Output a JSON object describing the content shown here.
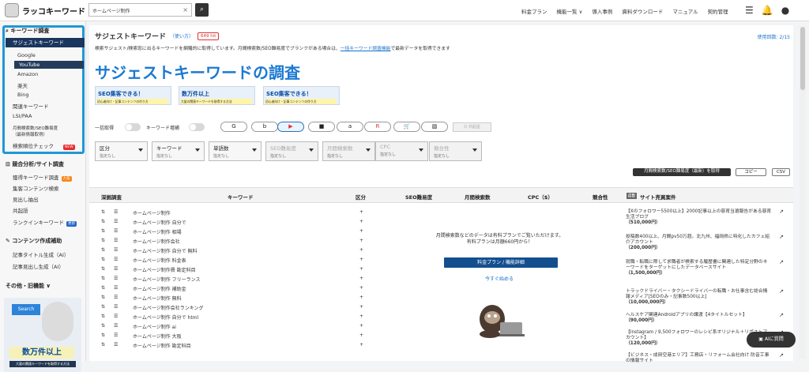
{
  "header": {
    "logo": "ラッコキーワード",
    "search_value": "ホームページ制作",
    "nav": [
      "料金プラン",
      "機能一覧 ∨",
      "導入事例",
      "資料ダウンロード",
      "マニュアル",
      "契約管理"
    ]
  },
  "sidebar": {
    "keyword_title": "キーワード調査",
    "active_item": "サジェストキーワード",
    "subitems": [
      "Google",
      "YouTube",
      "Amazon",
      "楽天",
      "Bing"
    ],
    "items": [
      "関連キーワード",
      "LSI/PAA",
      "月間検索数/SEO難易度",
      "（最新情報取得）",
      "検索順位チェック"
    ],
    "new_badge": "NEW",
    "competitor_title": "競合分析/サイト調査",
    "competitor_items": [
      "獲得キーワード調査",
      "集客コンテンツ検索",
      "見出し抽出",
      "共起語",
      "ランクインキーワード"
    ],
    "competitor_badge_1": "人気",
    "competitor_badge_2": "更新",
    "content_title": "コンテンツ作成補助",
    "content_items": [
      "記事タイトル生成（AI）",
      "記事見出し生成（AI）"
    ],
    "other_title": "その他・旧機能 ∨"
  },
  "ad": {
    "small_label": "Search",
    "title": "数万件以上",
    "bottom": "大量の関連キーワードを取得する方法"
  },
  "main": {
    "title": "サジェストキーワード",
    "howto": "（使い方）",
    "count": "649 hit",
    "usage": "使用回数: 2/15",
    "description": "検索サジェスト/検索窓に出るキーワードを網羅的に取得しています。月間検索数/SEO難易度でブランクがある場合は、",
    "description_link": "一括キーワード調査機能",
    "description_tail": "で最新データを取得できます",
    "heading": "サジェストキーワードの調査",
    "banners": [
      {
        "title": "SEO集客できる！",
        "sub": "初心者向け・記事コンテンツの作り方"
      },
      {
        "title": "数万件以上",
        "sub": "大量の関連キーワードを取得する方法"
      },
      {
        "title": "SEO集客できる！",
        "sub": "初心者向け・記事コンテンツの作り方"
      }
    ],
    "toggle_bulk": "一括取得",
    "toggle_growth": "キーワード増補",
    "engines": [
      "G",
      "b",
      "▶",
      "■",
      "a",
      "R",
      "🛒",
      "▧"
    ],
    "related_button": "Q 共起語",
    "filters": [
      {
        "label": "区分",
        "value": "指定なし",
        "disabled": false
      },
      {
        "label": "キーワード",
        "value": "指定なし",
        "disabled": false
      },
      {
        "label": "単語数",
        "value": "指定なし",
        "disabled": false
      },
      {
        "label": "SEO難易度",
        "value": "指定なし",
        "disabled": true
      },
      {
        "label": "月間検索数",
        "value": "指定なし",
        "disabled": true
      },
      {
        "label": "CPC",
        "value": "指定なし",
        "disabled": true
      },
      {
        "label": "競合性",
        "value": "指定なし",
        "disabled": true
      }
    ],
    "action_fetch": "月間検索数/SEO難易度（最新）を取得",
    "action_copy": "コピー",
    "action_csv": "CSV"
  },
  "table": {
    "headers": [
      "深掘調査",
      "キーワード",
      "区分",
      "SEO難易度",
      "月間検索数",
      "CPC（$）",
      "競合性",
      "サイト売買案件"
    ],
    "rows": [
      "ホームページ制作",
      "ホームページ制作 自分で",
      "ホームページ制作 相場",
      "ホームページ制作会社",
      "ホームページ制作 自分で 無料",
      "ホームページ制作 料金表",
      "ホームページ制作費 勘定科目",
      "ホームページ制作 フリーランス",
      "ホームページ制作 補助金",
      "ホームページ制作 無料",
      "ホームページ制作会社ランキング",
      "ホームページ制作 自分で html",
      "ホームページ制作 ai",
      "ホームページ制作 大阪",
      "ホームページ制作 勘定科目"
    ],
    "paywall_text_1": "月間検索数などのデータは有料プランでご覧いただけます。",
    "paywall_text_2": "有料プランは月額660円から！",
    "paywall_button": "料金プラン / 機能詳細",
    "paywall_link": "今すぐ始める",
    "case_badge": "広告",
    "cases": [
      {
        "title": "【Xのフォロワー5500以上】2000記事以上の慈育当選報告がある慈育生活ブログ",
        "price": "（510,000円）"
      },
      {
        "title": "投稿数400以上、月間pv50万超。北九州、福岡県に特化したカフェ紹介アカウント",
        "price": "（200,000円）"
      },
      {
        "title": "就職・転職に際して求職者が検索する履歴書に関連した特定分野のキーワードをターゲットにしたデータベースサイト",
        "price": "（1,500,000円）"
      },
      {
        "title": "トラックドライバー・タクシードライバーの転職・お仕事含む総合情報メディア[SEOのみ・記事数500以上]",
        "price": "（10,000,000円）"
      },
      {
        "title": "ヘルスケア関連Androidアプリの譲渡【4タイトルセット】",
        "price": "（90,000円）"
      },
      {
        "title": "【Instagram / 9,500フォロワーのレシピ系オリジナル＋リポストアカウント】",
        "price": "（120,000円）"
      },
      {
        "title": "【ビジネス・成田空港エリア】工務店・リフォーム会社向け 防音工事の情報サイト",
        "price": ""
      }
    ]
  },
  "ai_button": "AIに質問"
}
